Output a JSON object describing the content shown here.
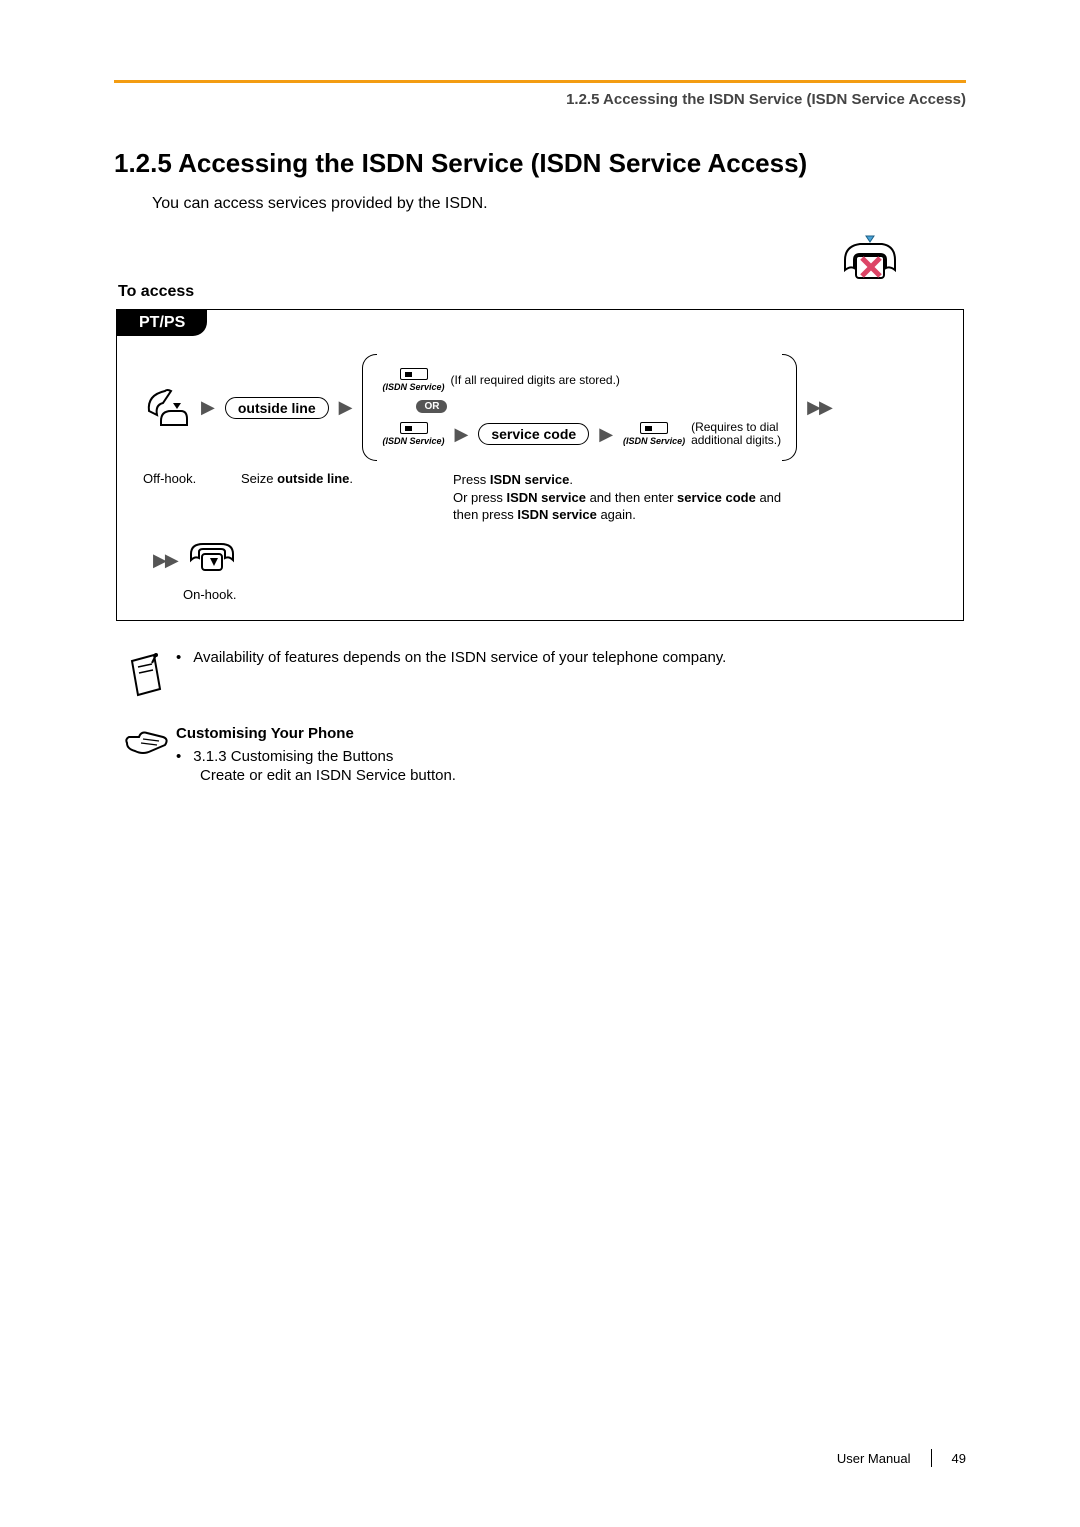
{
  "header": {
    "breadcrumb": "1.2.5 Accessing the ISDN Service (ISDN Service Access)"
  },
  "title": "1.2.5  Accessing the ISDN Service (ISDN Service Access)",
  "intro": "You can access services provided by the ISDN.",
  "subhead": "To access",
  "procedure": {
    "tab": "PT/PS",
    "offhook_caption": "Off-hook.",
    "seize_caption": "Seize outside line.",
    "outside_line_label": "outside line",
    "isdn_btn_label": "(ISDN Service)",
    "if_all_stored": "(If all required digits are stored.)",
    "or_label": "OR",
    "service_code_label": "service code",
    "requires_line1": "(Requires to dial",
    "requires_line2": "additional digits.)",
    "press_caption_prefix": "Press ",
    "press_caption_bold1": "ISDN service",
    "press_caption_mid1": ".",
    "press_caption_line2a": "Or press ",
    "press_caption_bold2": "ISDN service",
    "press_caption_line2b": " and then enter ",
    "press_caption_bold3": "service code",
    "press_caption_line2c": " and",
    "press_caption_line3a": "then press ",
    "press_caption_bold4": "ISDN service",
    "press_caption_line3b": " again.",
    "onhook_caption": "On-hook."
  },
  "note": {
    "bullet_text": "Availability of features depends on the ISDN service of your telephone company."
  },
  "customising": {
    "heading": "Customising Your Phone",
    "item_title": "3.1.3  Customising the Buttons",
    "item_desc": "Create or edit an ISDN Service button."
  },
  "footer": {
    "label": "User Manual",
    "page": "49"
  }
}
